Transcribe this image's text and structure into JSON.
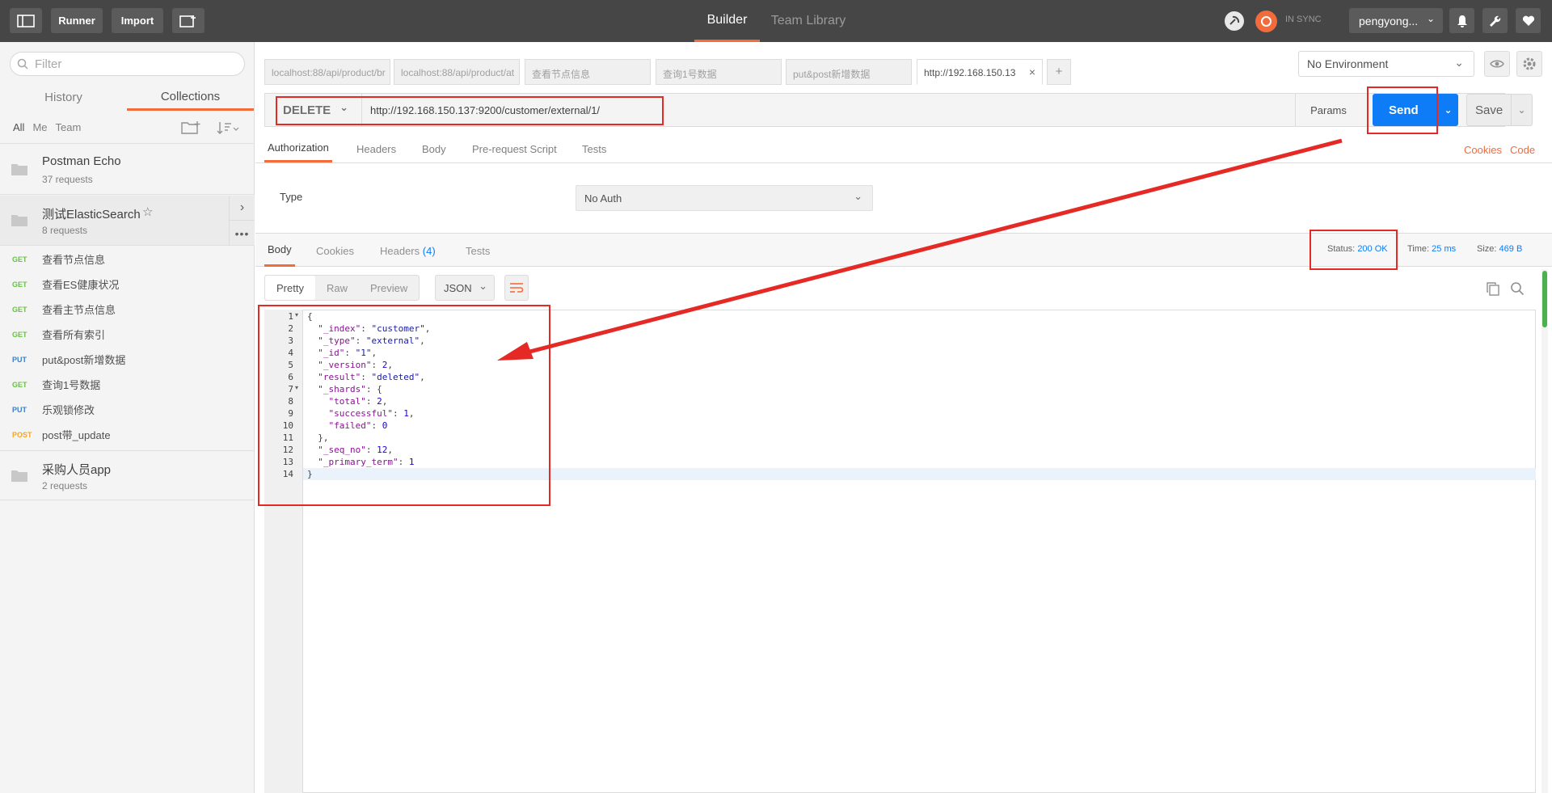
{
  "topbar": {
    "runner": "Runner",
    "import": "Import",
    "builder": "Builder",
    "team_library": "Team Library",
    "sync": "IN SYNC",
    "user": "pengyong..."
  },
  "sidebar": {
    "filter_placeholder": "Filter",
    "tabs": {
      "history": "History",
      "collections": "Collections"
    },
    "filters": {
      "all": "All",
      "me": "Me",
      "team": "Team"
    },
    "collections": [
      {
        "name": "Postman Echo",
        "count": "37 requests"
      },
      {
        "name": "测试ElasticSearch",
        "count": "8 requests"
      },
      {
        "name": "采购人员app",
        "count": "2 requests"
      }
    ],
    "requests": [
      {
        "method": "GET",
        "name": "查看节点信息"
      },
      {
        "method": "GET",
        "name": "查看ES健康状况"
      },
      {
        "method": "GET",
        "name": "查看主节点信息"
      },
      {
        "method": "GET",
        "name": "查看所有索引"
      },
      {
        "method": "PUT",
        "name": "put&post新增数据"
      },
      {
        "method": "GET",
        "name": "查询1号数据"
      },
      {
        "method": "PUT",
        "name": "乐观锁修改"
      },
      {
        "method": "POST",
        "name": "post带_update"
      }
    ]
  },
  "tabs": [
    "localhost:88/api/product/br",
    "localhost:88/api/product/at",
    "查看节点信息",
    "查询1号数据",
    "put&post新增数据",
    "http://192.168.150.13"
  ],
  "environment": "No Environment",
  "request": {
    "method": "DELETE",
    "url": "http://192.168.150.137:9200/customer/external/1/",
    "params": "Params",
    "send": "Send",
    "save": "Save"
  },
  "req_tabs": [
    "Authorization",
    "Headers",
    "Body",
    "Pre-request Script",
    "Tests"
  ],
  "links": {
    "cookies": "Cookies",
    "code": "Code"
  },
  "auth": {
    "type_label": "Type",
    "value": "No Auth"
  },
  "response": {
    "tabs": {
      "body": "Body",
      "cookies": "Cookies",
      "headers": "Headers",
      "headers_count": "(4)",
      "tests": "Tests"
    },
    "status_label": "Status:",
    "status": "200 OK",
    "time_label": "Time:",
    "time": "25 ms",
    "size_label": "Size:",
    "size": "469 B",
    "formats": [
      "Pretty",
      "Raw",
      "Preview"
    ],
    "lang": "JSON"
  },
  "code_lines": [
    "{",
    "  \"_index\": \"customer\",",
    "  \"_type\": \"external\",",
    "  \"_id\": \"1\",",
    "  \"_version\": 2,",
    "  \"result\": \"deleted\",",
    "  \"_shards\": {",
    "    \"total\": 2,",
    "    \"successful\": 1,",
    "    \"failed\": 0",
    "  },",
    "  \"_seq_no\": 12,",
    "  \"_primary_term\": 1",
    "}"
  ]
}
